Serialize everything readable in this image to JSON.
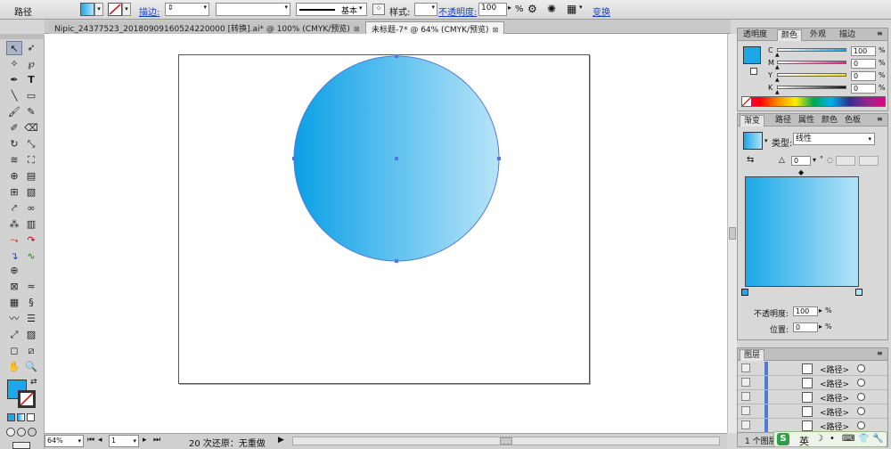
{
  "control_bar": {
    "object_type": "路径",
    "stroke_label": "描边:",
    "stroke_profile": "基本",
    "style_label": "样式:",
    "opacity_label": "不透明度:",
    "opacity_value": "100",
    "opacity_unit": "%",
    "transform_link": "变换"
  },
  "doc_tabs": [
    {
      "label": "Nipic_24377523_20180909160524220000  [转换].ai* @ 100% (CMYK/预览)",
      "close": "⊠"
    },
    {
      "label": "未标题-7* @ 64% (CMYK/预览)",
      "close": "⊠"
    }
  ],
  "color_panel": {
    "tabs": [
      "透明度",
      "颜色",
      "外观",
      "描边"
    ],
    "channels": [
      {
        "label": "C",
        "value": "100",
        "unit": "%",
        "color": "#1aa8e8"
      },
      {
        "label": "M",
        "value": "0",
        "unit": "%",
        "color": "#e0288c"
      },
      {
        "label": "Y",
        "value": "0",
        "unit": "%",
        "color": "#f2e600"
      },
      {
        "label": "K",
        "value": "0",
        "unit": "%",
        "color": "#111111"
      }
    ]
  },
  "gradient_panel": {
    "tabs": [
      "渐变",
      "路径",
      "属性",
      "颜色",
      "色板"
    ],
    "type_label": "类型:",
    "type_value": "线性",
    "angle_value": "0",
    "angle_unit": "°",
    "opacity_label": "不透明度:",
    "opacity_value": "100",
    "opacity_unit": "%",
    "position_label": "位置:",
    "position_value": "0",
    "position_unit": "%",
    "start_color": "#1aa8e8",
    "end_color": "#b3e3f7"
  },
  "layers_panel": {
    "tab": "图层",
    "rows": [
      {
        "name": "<路径>"
      },
      {
        "name": "<路径>"
      },
      {
        "name": "<路径>"
      },
      {
        "name": "<路径>"
      },
      {
        "name": "<路径>"
      }
    ],
    "footer_label": "1 个图层"
  },
  "status_bar": {
    "zoom": "64%",
    "page": "1",
    "undo_status": "20 次还原：无重做"
  },
  "ime_bar": {
    "lang": "英"
  },
  "artwork": {
    "circle_color_left": "#0aa0e6",
    "circle_color_right": "#b8e4f8"
  }
}
